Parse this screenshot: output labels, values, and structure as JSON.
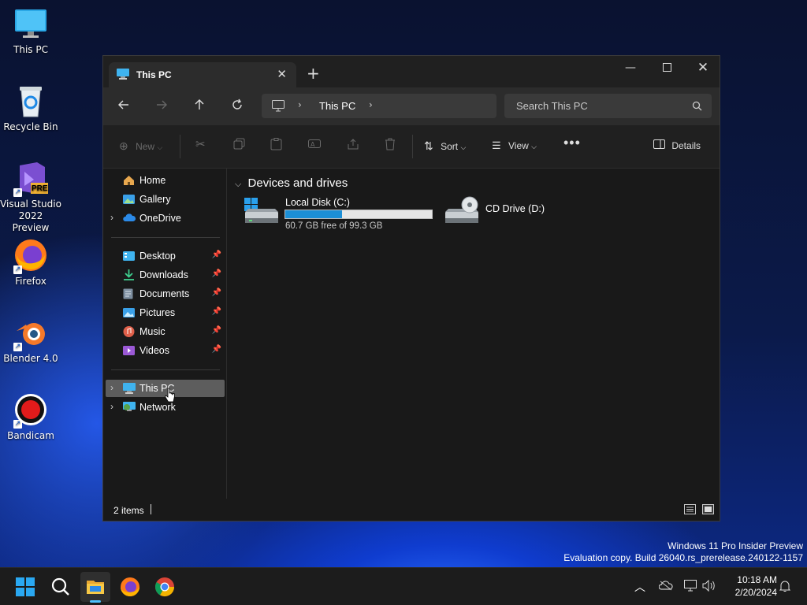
{
  "desktop": {
    "icons": [
      {
        "label": "This PC"
      },
      {
        "label": "Recycle Bin"
      },
      {
        "label": "Visual Studio 2022 Preview",
        "badge": "PRE"
      },
      {
        "label": "Firefox"
      },
      {
        "label": "Blender 4.0"
      },
      {
        "label": "Bandicam"
      }
    ]
  },
  "window": {
    "tab_title": "This PC",
    "tab_close": "✕",
    "new_tab": "+",
    "address_path": [
      "This PC"
    ],
    "search_placeholder": "Search This PC",
    "toolbar": {
      "new_label": "New",
      "sort_label": "Sort",
      "view_label": "View",
      "details_label": "Details"
    },
    "sidebar": {
      "top": [
        {
          "label": "Home",
          "icon": "home-icon"
        },
        {
          "label": "Gallery",
          "icon": "gallery-icon"
        },
        {
          "label": "OneDrive",
          "icon": "onedrive-icon"
        }
      ],
      "pinned": [
        {
          "label": "Desktop",
          "icon": "desktop-folder-icon"
        },
        {
          "label": "Downloads",
          "icon": "downloads-icon"
        },
        {
          "label": "Documents",
          "icon": "documents-icon"
        },
        {
          "label": "Pictures",
          "icon": "pictures-icon"
        },
        {
          "label": "Music",
          "icon": "music-icon"
        },
        {
          "label": "Videos",
          "icon": "videos-icon"
        }
      ],
      "bottom": [
        {
          "label": "This PC",
          "icon": "this-pc-icon",
          "selected": true
        },
        {
          "label": "Network",
          "icon": "network-icon"
        }
      ]
    },
    "content": {
      "group_title": "Devices and drives",
      "drives": [
        {
          "name": "Local Disk (C:)",
          "free_text": "60.7 GB free of 99.3 GB",
          "used_fraction": 0.389
        },
        {
          "name": "CD Drive (D:)"
        }
      ]
    },
    "status": {
      "items_text": "2 items"
    }
  },
  "watermark": {
    "line1": "Windows 11 Pro Insider Preview",
    "line2": "Evaluation copy. Build 26040.rs_prerelease.240122-1157"
  },
  "taskbar": {
    "time": "10:18 AM",
    "date": "2/20/2024"
  },
  "colors": {
    "accent": "#1c8fd6",
    "selected": "#5d5d5d"
  }
}
